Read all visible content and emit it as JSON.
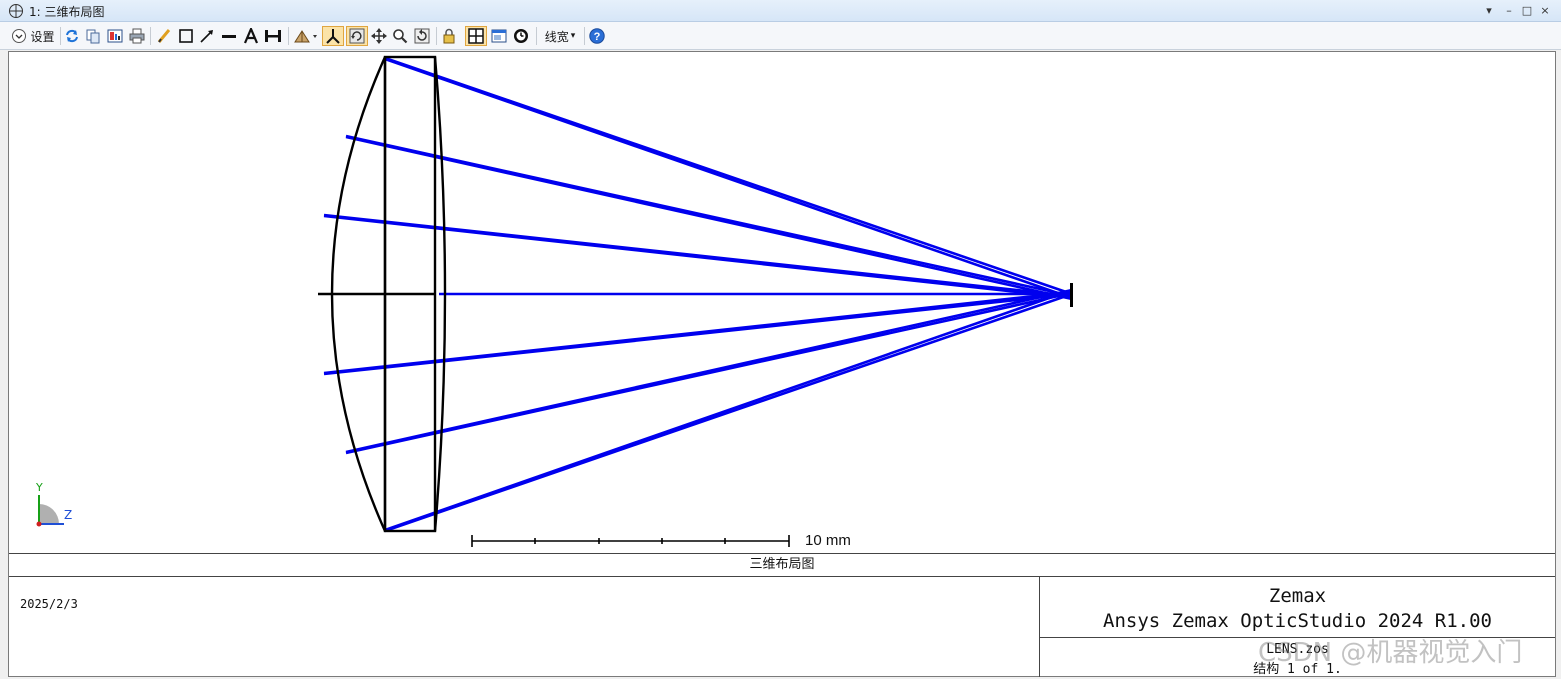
{
  "window": {
    "title": "1: 三维布局图",
    "controls": [
      "▾",
      "–",
      "□",
      "×"
    ]
  },
  "toolbar": {
    "settings_label": "设置",
    "linewidth_label": "线宽",
    "linewidth_caret": "▾",
    "help_icon": "?"
  },
  "plot": {
    "scale_bar_label": "10 mm",
    "axis_y": "Y",
    "axis_z": "Z"
  },
  "footer": {
    "caption": "三维布局图",
    "date": "2025/2/3",
    "brand": "Zemax",
    "product": "Ansys Zemax OpticStudio 2024 R1.00",
    "file": "LENS.zos",
    "configuration": "结构 1 of 1."
  },
  "watermark": "CSDN @机器视觉入门",
  "colors": {
    "ray": "#0000ee",
    "lens_outline": "#000000",
    "active_button_bg": "#fbe3a8"
  }
}
